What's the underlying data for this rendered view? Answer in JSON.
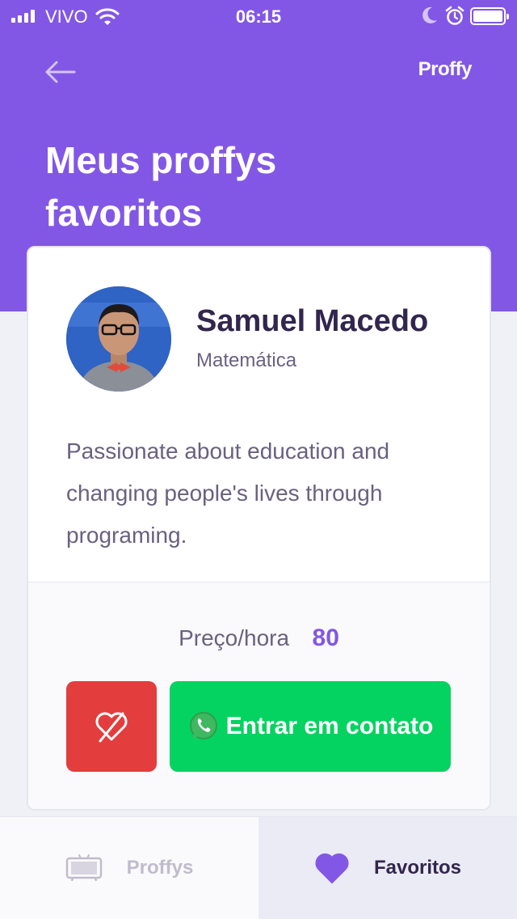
{
  "status_bar": {
    "carrier": "VIVO",
    "time": "06:15"
  },
  "header": {
    "logo": "Proffy",
    "title": "Meus proffys favoritos"
  },
  "teacher": {
    "name": "Samuel Macedo",
    "subject": "Matemática",
    "bio": "Passionate about education and changing people's lives through programing.",
    "price_label": "Preço/hora",
    "price_value": "80",
    "contact_label": "Entrar em contato"
  },
  "tabs": [
    {
      "label": "Proffys",
      "active": false
    },
    {
      "label": "Favoritos",
      "active": true
    }
  ],
  "icons": {
    "back": "arrow-left-icon",
    "unfavorite": "heart-outline-slash-icon",
    "contact": "whatsapp-icon",
    "proffys_tab": "tv-icon",
    "favoritos_tab": "heart-icon"
  },
  "colors": {
    "primary": "#8257e5",
    "background": "#f0f0f7",
    "title_text": "#32264d",
    "body_text": "#6a6180",
    "danger": "#e33d3d",
    "success": "#04d361",
    "muted": "#c1bccc"
  }
}
